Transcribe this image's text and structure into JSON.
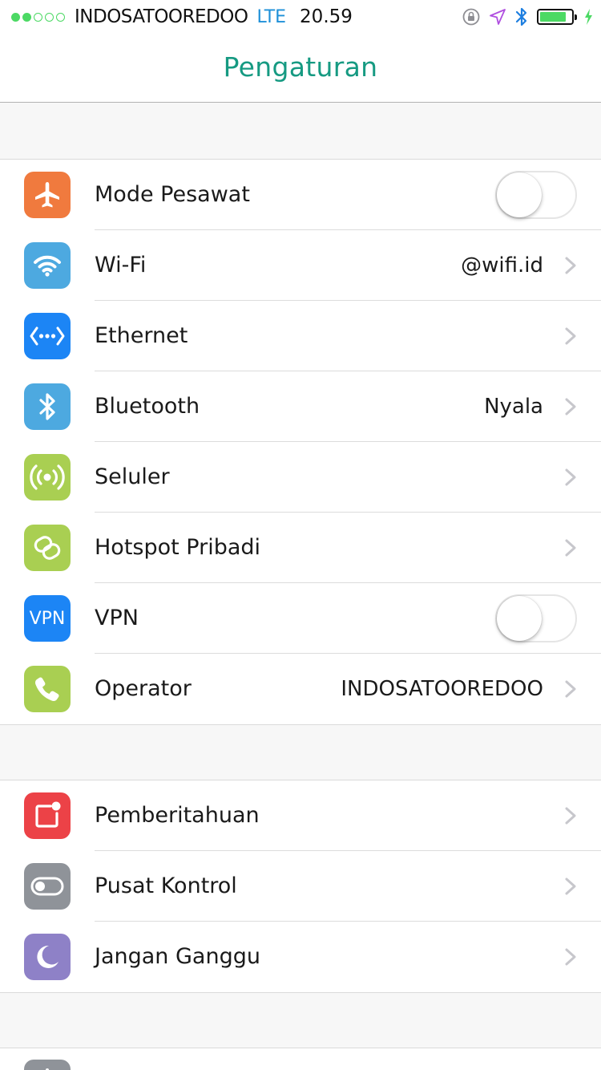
{
  "status_bar": {
    "signal_bars_full": 2,
    "signal_bars_total": 5,
    "carrier": "INDOSATOOREDOO",
    "network": "LTE",
    "time": "20.59",
    "battery_level": 0.85,
    "icons": [
      "rotation-lock-icon",
      "location-icon",
      "bluetooth-icon",
      "battery-icon",
      "charging-icon"
    ]
  },
  "nav": {
    "title": "Pengaturan"
  },
  "colors": {
    "title": "#169a82",
    "orange": "#f07a3e",
    "blue": "#4da9e0",
    "deep_blue": "#1c85f5",
    "green": "#a9cf52",
    "red": "#ec4247",
    "gray": "#8f9399",
    "purple": "#8e81c7",
    "chevron": "#c7c7cc"
  },
  "groups": [
    {
      "rows": [
        {
          "label": "Mode Pesawat",
          "icon": "airplane-icon",
          "accessory": "toggle",
          "on": false
        },
        {
          "label": "Wi-Fi",
          "icon": "wifi-icon",
          "value": "@wifi.id",
          "accessory": "chevron"
        },
        {
          "label": "Ethernet",
          "icon": "ethernet-icon",
          "accessory": "chevron"
        },
        {
          "label": "Bluetooth",
          "icon": "bluetooth-icon",
          "value": "Nyala",
          "accessory": "chevron"
        },
        {
          "label": "Seluler",
          "icon": "cellular-icon",
          "accessory": "chevron"
        },
        {
          "label": "Hotspot Pribadi",
          "icon": "hotspot-icon",
          "accessory": "chevron"
        },
        {
          "label": "VPN",
          "icon": "vpn-icon",
          "icon_text": "VPN",
          "accessory": "toggle",
          "on": false
        },
        {
          "label": "Operator",
          "icon": "phone-icon",
          "value": "INDOSATOOREDOO",
          "accessory": "chevron"
        }
      ]
    },
    {
      "rows": [
        {
          "label": "Pemberitahuan",
          "icon": "notifications-icon",
          "accessory": "chevron"
        },
        {
          "label": "Pusat Kontrol",
          "icon": "control-center-icon",
          "accessory": "chevron"
        },
        {
          "label": "Jangan Ganggu",
          "icon": "moon-icon",
          "accessory": "chevron"
        }
      ]
    }
  ]
}
